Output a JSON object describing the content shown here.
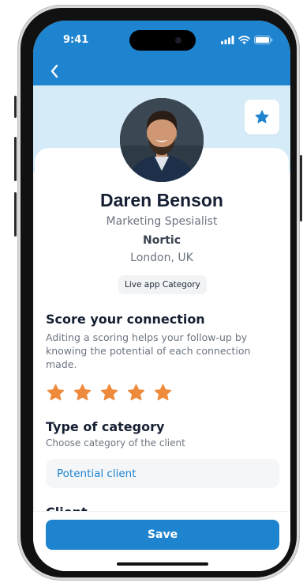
{
  "status_bar": {
    "time": "9:41"
  },
  "profile": {
    "name": "Daren Benson",
    "role": "Marketing Spesialist",
    "company": "Nortic",
    "location": "London, UK",
    "category_chip": "Live app Category"
  },
  "score": {
    "title": "Score your connection",
    "description": "Aditing a scoring helps your follow-up by knowing the potential of each connection made.",
    "rating": 5,
    "max_rating": 5,
    "star_color": "#ee8a3c"
  },
  "category": {
    "title": "Type of category",
    "subtitle": "Choose category of the client",
    "selected": "Potential client"
  },
  "client_section": {
    "title": "Client"
  },
  "footer": {
    "save_label": "Save"
  },
  "colors": {
    "primary": "#1f84cf",
    "cover": "#d6ebf8"
  },
  "icons": [
    "back-arrow-icon",
    "star-icon",
    "signal-icon",
    "wifi-icon",
    "battery-icon"
  ]
}
